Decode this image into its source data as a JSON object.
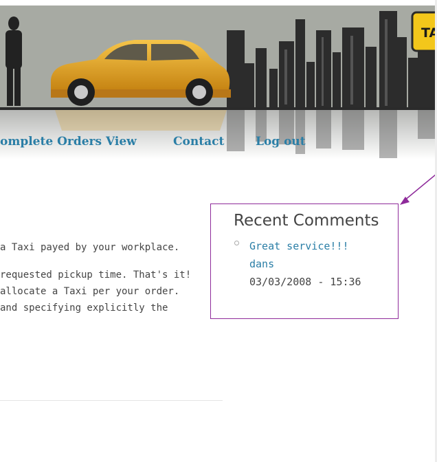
{
  "nav": {
    "items": [
      {
        "label": "omplete Orders View"
      },
      {
        "label": "Contact"
      },
      {
        "label": "Log out"
      }
    ]
  },
  "header": {
    "sign_text": "TA",
    "colors": {
      "sky": "#a7aaa3",
      "car": "#e8a623",
      "sign": "#f3c71b"
    }
  },
  "main": {
    "lines": [
      "a Taxi payed by your workplace.",
      "requested pickup time. That's it!",
      "allocate a Taxi per your order.",
      "and specifying explicitly the"
    ]
  },
  "sidebar": {
    "recent_comments": {
      "title": "Recent Comments",
      "items": [
        {
          "text": "Great service!!!",
          "author": "dans",
          "date": "03/03/2008 - 15:36"
        }
      ]
    }
  },
  "colors": {
    "link": "#2a7ea6",
    "annotation": "#8e2a9a",
    "text": "#444444"
  }
}
